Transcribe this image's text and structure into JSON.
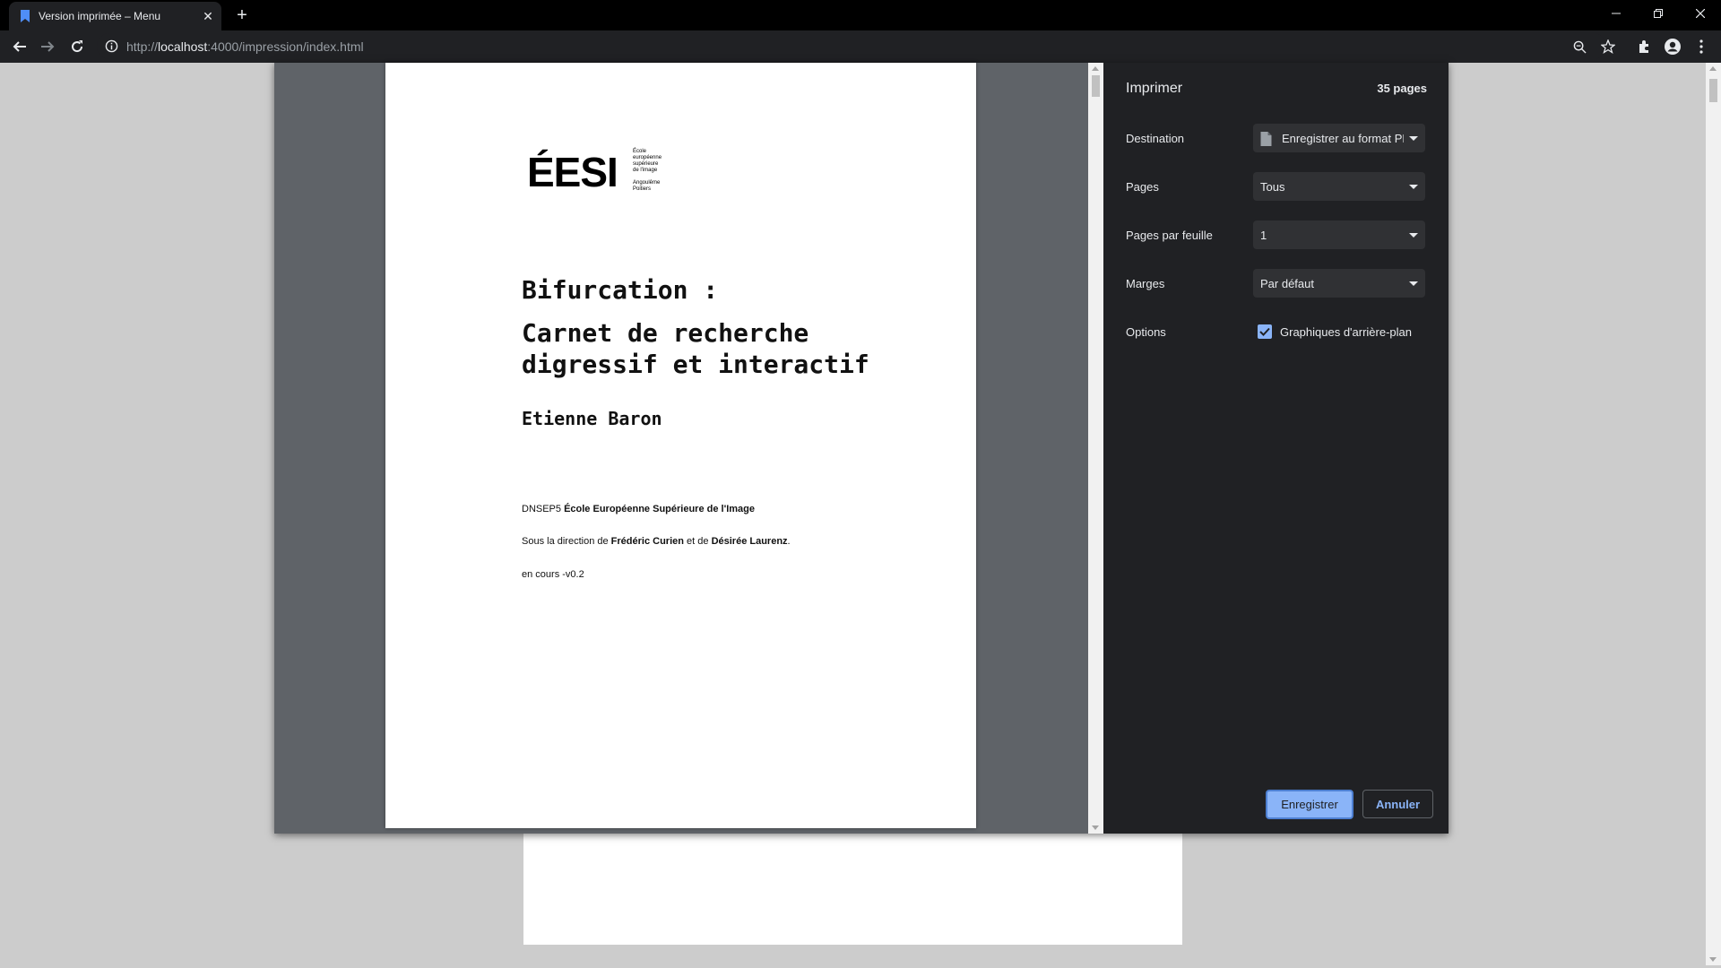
{
  "browser": {
    "tab_title": "Version imprimée – Menu",
    "url_prefix": "http://",
    "url_host": "localhost",
    "url_rest": ":4000/impression/index.html"
  },
  "document": {
    "logo_text": "ÉESI",
    "logo_small": "École\neuropéenne\nsupérieure\nde l'image\n\nAngoulême\nPoitiers",
    "title_line1": "Bifurcation :",
    "title_line2": "Carnet de recherche",
    "title_line3": "digressif et interactif",
    "author": "Etienne Baron",
    "school_prefix": "DNSEP5 ",
    "school_name": "École Européenne Supérieure de l'Image",
    "direction_prefix": "Sous la direction de ",
    "director1": "Frédéric Curien",
    "direction_and": " et de ",
    "director2": "Désirée Laurenz",
    "direction_suffix": ".",
    "status": "en cours -v0.2"
  },
  "print": {
    "title": "Imprimer",
    "page_count": "35 pages",
    "destination_label": "Destination",
    "destination_value": "Enregistrer au format PDF",
    "pages_label": "Pages",
    "pages_value": "Tous",
    "pps_label": "Pages par feuille",
    "pps_value": "1",
    "margins_label": "Marges",
    "margins_value": "Par défaut",
    "options_label": "Options",
    "background_graphics_label": "Graphiques d'arrière-plan",
    "background_graphics_checked": true,
    "save_label": "Enregistrer",
    "cancel_label": "Annuler"
  },
  "colors": {
    "accent": "#8ab4f8",
    "dialog_bg": "#202124",
    "preview_bg": "#5f6368"
  }
}
